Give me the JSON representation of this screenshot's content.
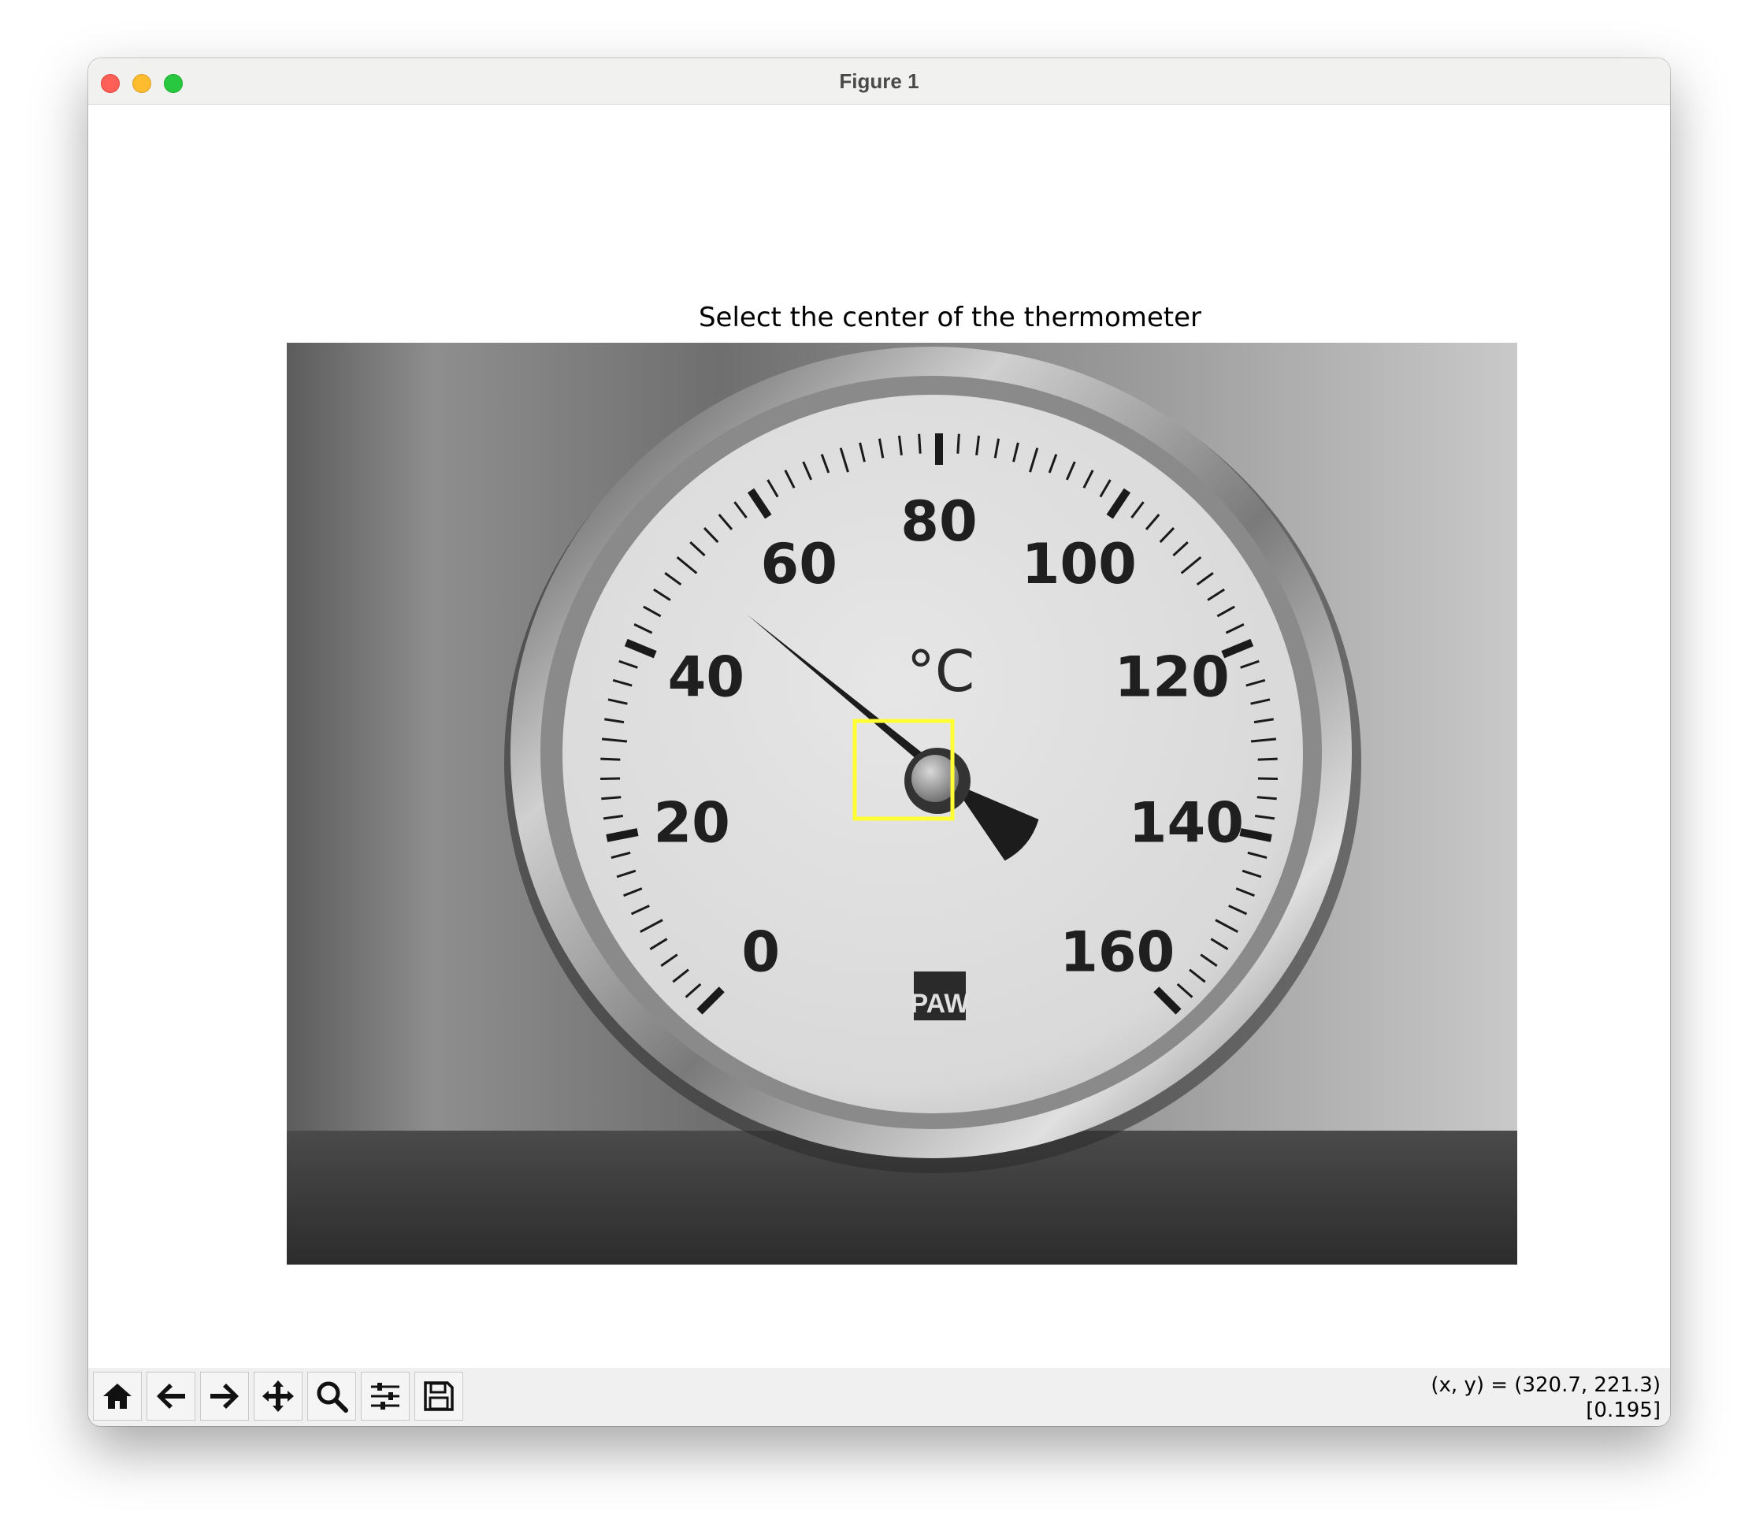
{
  "window": {
    "title": "Figure 1"
  },
  "figure": {
    "title": "Select the center of the thermometer"
  },
  "thermometer": {
    "unit": "°C",
    "scale_labels": [
      "0",
      "20",
      "40",
      "60",
      "80",
      "100",
      "120",
      "140",
      "160"
    ],
    "brand": "PAW",
    "needle_reading": 50
  },
  "toolbar": {
    "buttons": [
      {
        "name": "home",
        "icon": "home-icon"
      },
      {
        "name": "back",
        "icon": "arrow-left-icon"
      },
      {
        "name": "forward",
        "icon": "arrow-right-icon"
      },
      {
        "name": "pan",
        "icon": "move-icon"
      },
      {
        "name": "zoom",
        "icon": "magnifier-icon"
      },
      {
        "name": "configure-subplots",
        "icon": "sliders-icon"
      },
      {
        "name": "save",
        "icon": "floppy-disk-icon"
      }
    ]
  },
  "status": {
    "coords": "(x, y) = (320.7, 221.3)",
    "value": "[0.195]"
  },
  "colors": {
    "selection_box": "#ffff33"
  }
}
